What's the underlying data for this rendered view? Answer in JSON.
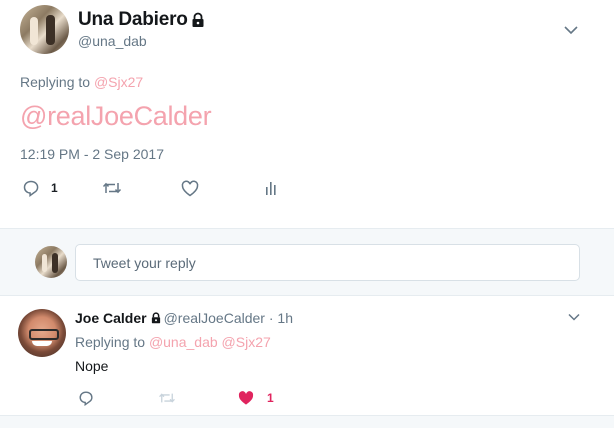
{
  "main_tweet": {
    "author_name": "Una Dabiero",
    "author_handle": "@una_dab",
    "replying_prefix": "Replying to",
    "replying_to": "@Sjx27",
    "text": "@realJoeCalder",
    "timestamp": "12:19 PM - 2 Sep 2017",
    "reply_count": "1"
  },
  "reply_box": {
    "placeholder": "Tweet your reply"
  },
  "reply_tweet": {
    "author_name": "Joe Calder",
    "author_handle": "@realJoeCalder",
    "separator": "·",
    "time_ago": "1h",
    "replying_prefix": "Replying to",
    "replying_to_1": "@una_dab",
    "replying_to_2": "@Sjx27",
    "text": "Nope",
    "like_count": "1"
  },
  "colors": {
    "mention": "#f4a3ae",
    "like_active": "#e0245e",
    "muted": "#657786",
    "icon": "#657786"
  },
  "icons": [
    "lock-icon",
    "chevron-down-icon",
    "reply-icon",
    "retweet-icon",
    "like-icon",
    "analytics-icon",
    "heart-filled-icon"
  ]
}
